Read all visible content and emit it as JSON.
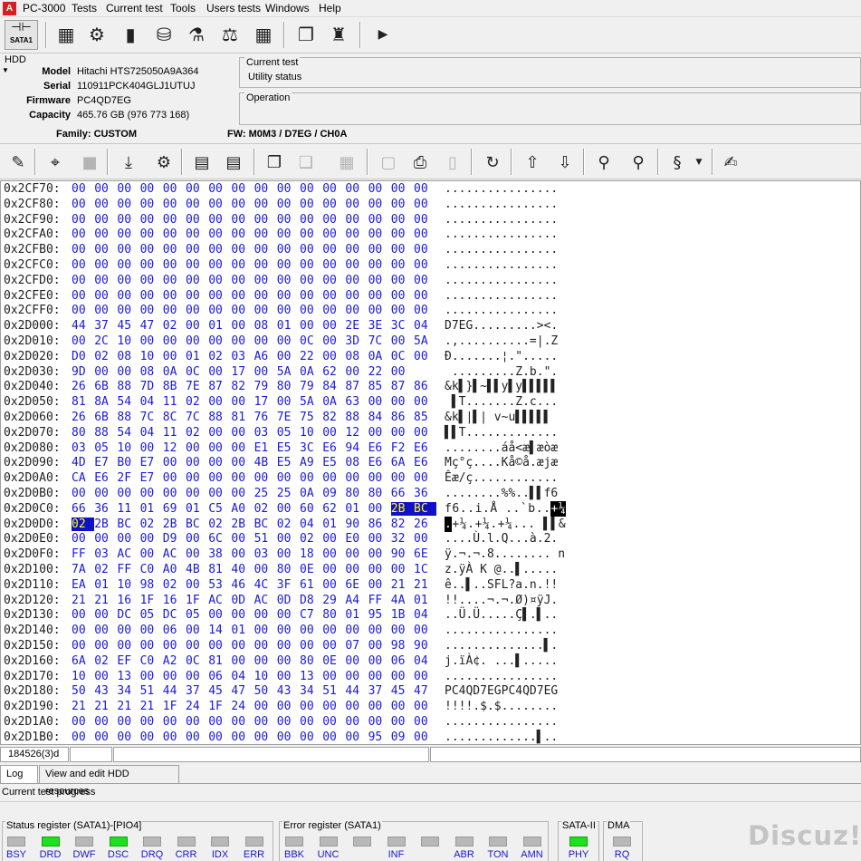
{
  "app": {
    "title": "PC-3000",
    "logo_text": "A"
  },
  "menu": [
    "Tests",
    "Current test",
    "Tools",
    "Users tests",
    "Windows",
    "Help"
  ],
  "toolbar1": {
    "sata_label": "SATA1",
    "icons": [
      "hdd-table-icon",
      "hdd-gear-icon",
      "chip-icon",
      "drive-icon",
      "flask-icon",
      "balance-icon",
      "grid-icon",
      "copy-windows-icon",
      "person-door-icon",
      "play-icon"
    ]
  },
  "hdd": {
    "title": "HDD",
    "model_label": "Model",
    "model": "Hitachi HTS725050A9A364",
    "serial_label": "Serial",
    "serial": "110911PCK404GLJ1UTUJ",
    "firmware_label": "Firmware",
    "firmware": "PC4QD7EG",
    "capacity_label": "Capacity",
    "capacity": "465.76 GB (976 773 168)"
  },
  "current_test": {
    "title": "Current test",
    "status": "Utility status"
  },
  "operation": {
    "title": "Operation"
  },
  "family": "Family: CUSTOM",
  "fw": "FW: M0M3 / D7EG / CH0A",
  "hex": {
    "selection_color": "#1010c8",
    "rows": [
      {
        "addr": "0x2CF70:",
        "bytes": "00 00 00 00 00 00 00 00 00 00 00 00 00 00 00 00",
        "ascii": "................"
      },
      {
        "addr": "0x2CF80:",
        "bytes": "00 00 00 00 00 00 00 00 00 00 00 00 00 00 00 00",
        "ascii": "................"
      },
      {
        "addr": "0x2CF90:",
        "bytes": "00 00 00 00 00 00 00 00 00 00 00 00 00 00 00 00",
        "ascii": "................"
      },
      {
        "addr": "0x2CFA0:",
        "bytes": "00 00 00 00 00 00 00 00 00 00 00 00 00 00 00 00",
        "ascii": "................"
      },
      {
        "addr": "0x2CFB0:",
        "bytes": "00 00 00 00 00 00 00 00 00 00 00 00 00 00 00 00",
        "ascii": "................"
      },
      {
        "addr": "0x2CFC0:",
        "bytes": "00 00 00 00 00 00 00 00 00 00 00 00 00 00 00 00",
        "ascii": "................"
      },
      {
        "addr": "0x2CFD0:",
        "bytes": "00 00 00 00 00 00 00 00 00 00 00 00 00 00 00 00",
        "ascii": "................"
      },
      {
        "addr": "0x2CFE0:",
        "bytes": "00 00 00 00 00 00 00 00 00 00 00 00 00 00 00 00",
        "ascii": "................"
      },
      {
        "addr": "0x2CFF0:",
        "bytes": "00 00 00 00 00 00 00 00 00 00 00 00 00 00 00 00",
        "ascii": "................"
      },
      {
        "addr": "0x2D000:",
        "bytes": "44 37 45 47 02 00 01 00 08 01 00 00 2E 3E 3C 04",
        "ascii": "D7EG.........><."
      },
      {
        "addr": "0x2D010:",
        "bytes": "00 2C 10 00 00 00 00 00 00 00 0C 00 3D 7C 00 5A",
        "ascii": ".,..........=|.Z"
      },
      {
        "addr": "0x2D020:",
        "bytes": "D0 02 08 10 00 01 02 03 A6 00 22 00 08 0A 0C 00",
        "ascii": "Ð.......¦.\"....."
      },
      {
        "addr": "0x2D030:",
        "bytes": "9D 00 00 08 0A 0C 00 17 00 5A 0A 62 00 22 00",
        "ascii": " .........Z.b.\"."
      },
      {
        "addr": "0x2D040:",
        "bytes": "26 6B 88 7D 8B 7E 87 82 79 80 79 84 87 85 87 86",
        "ascii": "&k▌}▌~▌▌y▌y▌▌▌▌▌"
      },
      {
        "addr": "0x2D050:",
        "bytes": "81 8A 54 04 11 02 00 00 17 00 5A 0A 63 00 00 00",
        "ascii": " ▌T.......Z.c..."
      },
      {
        "addr": "0x2D060:",
        "bytes": "26 6B 88 7C 8C 7C 88 81 76 7E 75 82 88 84 86 85",
        "ascii": "&k▌|▌| v~u▌▌▌▌▌"
      },
      {
        "addr": "0x2D070:",
        "bytes": "80 88 54 04 11 02 00 00 03 05 10 00 12 00 00 00",
        "ascii": "▌▌T............."
      },
      {
        "addr": "0x2D080:",
        "bytes": "03 05 10 00 12 00 00 00 E1 E5 3C E6 94 E6 F2 E6",
        "ascii": "........áå<æ▌æòæ"
      },
      {
        "addr": "0x2D090:",
        "bytes": "4D E7 B0 E7 00 00 00 00 4B E5 A9 E5 08 E6 6A E6",
        "ascii": "Mç°ç....Kå©å.æjæ"
      },
      {
        "addr": "0x2D0A0:",
        "bytes": "CA E6 2F E7 00 00 00 00 00 00 00 00 00 00 00 00",
        "ascii": "Êæ/ç............"
      },
      {
        "addr": "0x2D0B0:",
        "bytes": "00 00 00 00 00 00 00 00 25 25 0A 09 80 80 66 36",
        "ascii": "........%%..▌▌f6"
      },
      {
        "addr": "0x2D0C0:",
        "bytes": "66 36 11 01 69 01 C5 A0 02 00 60 62 01 00 2B BC",
        "ascii": "f6..i.Å ..`b..+¼",
        "sel_bytes": [
          14,
          15
        ],
        "sel_ascii": [
          14,
          15
        ]
      },
      {
        "addr": "0x2D0D0:",
        "bytes": "02 2B BC 02 2B BC 02 2B BC 02 04 01 90 86 82 26",
        "ascii": ".+¼.+¼.+¼... ▌▌&",
        "sel_bytes": [
          0
        ],
        "sel_ascii": [
          0
        ]
      },
      {
        "addr": "0x2D0E0:",
        "bytes": "00 00 00 00 D9 00 6C 00 51 00 02 00 E0 00 32 00",
        "ascii": "....Ù.l.Q...à.2."
      },
      {
        "addr": "0x2D0F0:",
        "bytes": "FF 03 AC 00 AC 00 38 00 03 00 18 00 00 00 90 6E",
        "ascii": "ÿ.¬.¬.8........ n"
      },
      {
        "addr": "0x2D100:",
        "bytes": "7A 02 FF C0 A0 4B 81 40 00 80 0E 00 00 00 00 1C",
        "ascii": "z.ÿÀ K @..▌....."
      },
      {
        "addr": "0x2D110:",
        "bytes": "EA 01 10 98 02 00 53 46 4C 3F 61 00 6E 00 21 21",
        "ascii": "ê..▌..SFL?a.n.!!"
      },
      {
        "addr": "0x2D120:",
        "bytes": "21 21 16 1F 16 1F AC 0D AC 0D D8 29 A4 FF 4A 01",
        "ascii": "!!....¬.¬.Ø)¤ÿJ."
      },
      {
        "addr": "0x2D130:",
        "bytes": "00 00 DC 05 DC 05 00 00 00 00 C7 80 01 95 1B 04",
        "ascii": "..Ü.Ü.....Ç▌.▌.."
      },
      {
        "addr": "0x2D140:",
        "bytes": "00 00 00 00 06 00 14 01 00 00 00 00 00 00 00 00",
        "ascii": "................"
      },
      {
        "addr": "0x2D150:",
        "bytes": "00 00 00 00 00 00 00 00 00 00 00 00 07 00 98 90",
        "ascii": "..............▌."
      },
      {
        "addr": "0x2D160:",
        "bytes": "6A 02 EF C0 A2 0C 81 00 00 00 80 0E 00 00 06 04",
        "ascii": "j.ïÀ¢. ...▌....."
      },
      {
        "addr": "0x2D170:",
        "bytes": "10 00 13 00 00 00 06 04 10 00 13 00 00 00 00 00",
        "ascii": "................"
      },
      {
        "addr": "0x2D180:",
        "bytes": "50 43 34 51 44 37 45 47 50 43 34 51 44 37 45 47",
        "ascii": "PC4QD7EGPC4QD7EG"
      },
      {
        "addr": "0x2D190:",
        "bytes": "21 21 21 21 1F 24 1F 24 00 00 00 00 00 00 00 00",
        "ascii": "!!!!.$.$........"
      },
      {
        "addr": "0x2D1A0:",
        "bytes": "00 00 00 00 00 00 00 00 00 00 00 00 00 00 00 00",
        "ascii": "................"
      },
      {
        "addr": "0x2D1B0:",
        "bytes": "00 00 00 00 00 00 00 00 00 00 00 00 00 95 09 00",
        "ascii": ".............▌.."
      }
    ]
  },
  "status": {
    "position": "184526(3)d"
  },
  "tabs": {
    "log": "Log",
    "resources": "View and edit HDD resources"
  },
  "progress": {
    "label": "Current test progress"
  },
  "registers": {
    "status_title": "Status register (SATA1)-[PIO4]",
    "status_leds": [
      {
        "n": "BSY",
        "on": false
      },
      {
        "n": "DRD",
        "on": true
      },
      {
        "n": "DWF",
        "on": false
      },
      {
        "n": "DSC",
        "on": true
      },
      {
        "n": "DRQ",
        "on": false
      },
      {
        "n": "CRR",
        "on": false
      },
      {
        "n": "IDX",
        "on": false
      },
      {
        "n": "ERR",
        "on": false
      }
    ],
    "error_title": "Error register (SATA1)",
    "error_leds": [
      {
        "n": "BBK",
        "on": false
      },
      {
        "n": "UNC",
        "on": false
      },
      {
        "n": "",
        "on": false
      },
      {
        "n": "INF",
        "on": false
      },
      {
        "n": "",
        "on": false
      },
      {
        "n": "ABR",
        "on": false
      },
      {
        "n": "TON",
        "on": false
      },
      {
        "n": "AMN",
        "on": false
      }
    ],
    "sata_title": "SATA-II",
    "sata_leds": [
      {
        "n": "PHY",
        "on": true
      }
    ],
    "dma_title": "DMA",
    "dma_leds": [
      {
        "n": "RQ",
        "on": false
      }
    ]
  },
  "watermark": "Discuz!"
}
